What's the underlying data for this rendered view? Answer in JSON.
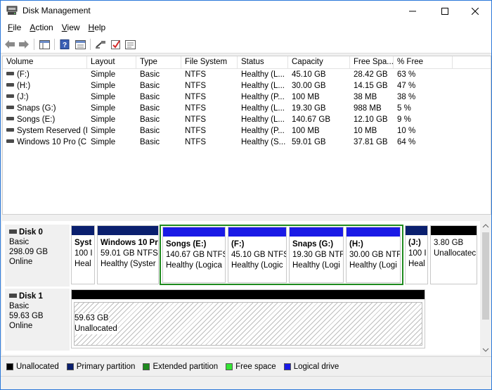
{
  "window": {
    "title": "Disk Management"
  },
  "menu": [
    {
      "label": "File",
      "key": "F",
      "rest": "ile"
    },
    {
      "label": "Action",
      "key": "A",
      "rest": "ction"
    },
    {
      "label": "View",
      "key": "V",
      "rest": "iew"
    },
    {
      "label": "Help",
      "key": "H",
      "rest": "elp"
    }
  ],
  "columns": [
    "Volume",
    "Layout",
    "Type",
    "File System",
    "Status",
    "Capacity",
    "Free Spa...",
    "% Free"
  ],
  "volumes": [
    {
      "volume": "(F:)",
      "layout": "Simple",
      "type": "Basic",
      "fs": "NTFS",
      "status": "Healthy (L...",
      "capacity": "45.10 GB",
      "free": "28.42 GB",
      "pct": "63 %"
    },
    {
      "volume": "(H:)",
      "layout": "Simple",
      "type": "Basic",
      "fs": "NTFS",
      "status": "Healthy (L...",
      "capacity": "30.00 GB",
      "free": "14.15 GB",
      "pct": "47 %"
    },
    {
      "volume": "(J:)",
      "layout": "Simple",
      "type": "Basic",
      "fs": "NTFS",
      "status": "Healthy (P...",
      "capacity": "100 MB",
      "free": "38 MB",
      "pct": "38 %"
    },
    {
      "volume": "Snaps (G:)",
      "layout": "Simple",
      "type": "Basic",
      "fs": "NTFS",
      "status": "Healthy (L...",
      "capacity": "19.30 GB",
      "free": "988 MB",
      "pct": "5 %"
    },
    {
      "volume": "Songs (E:)",
      "layout": "Simple",
      "type": "Basic",
      "fs": "NTFS",
      "status": "Healthy (L...",
      "capacity": "140.67 GB",
      "free": "12.10 GB",
      "pct": "9 %"
    },
    {
      "volume": "System Reserved (I:)",
      "layout": "Simple",
      "type": "Basic",
      "fs": "NTFS",
      "status": "Healthy (P...",
      "capacity": "100 MB",
      "free": "10 MB",
      "pct": "10 %"
    },
    {
      "volume": "Windows 10 Pro (C:)",
      "layout": "Simple",
      "type": "Basic",
      "fs": "NTFS",
      "status": "Healthy (S...",
      "capacity": "59.01 GB",
      "free": "37.81 GB",
      "pct": "64 %"
    }
  ],
  "disks": {
    "disk0": {
      "name": "Disk 0",
      "type": "Basic",
      "size": "298.09 GB",
      "state": "Online",
      "partitions": [
        {
          "line1": "Syst",
          "line2": "100 I",
          "line3": "Heal",
          "kind": "primary"
        },
        {
          "line1": "Windows 10 Pr",
          "line2": "59.01 GB NTFS",
          "line3": "Healthy (Syster",
          "kind": "primary"
        },
        {
          "line1": "Songs  (E:)",
          "line2": "140.67 GB NTFS",
          "line3": "Healthy (Logica",
          "kind": "logical"
        },
        {
          "line1": "(F:)",
          "line2": "45.10 GB NTFS",
          "line3": "Healthy (Logic",
          "kind": "logical"
        },
        {
          "line1": "Snaps  (G:)",
          "line2": "19.30 GB NTF",
          "line3": "Healthy (Logi",
          "kind": "logical"
        },
        {
          "line1": "(H:)",
          "line2": "30.00 GB NTF",
          "line3": "Healthy (Logi",
          "kind": "logical"
        },
        {
          "line1": "(J:)",
          "line2": "100 I",
          "line3": "Heal",
          "kind": "primary"
        },
        {
          "line1": "",
          "line2": "3.80 GB",
          "line3": "Unallocatec",
          "kind": "unallocated"
        }
      ]
    },
    "disk1": {
      "name": "Disk 1",
      "type": "Basic",
      "size": "59.63 GB",
      "state": "Online",
      "partitions": [
        {
          "line1": "59.63 GB",
          "line2": "Unallocated",
          "kind": "unallocated"
        }
      ]
    }
  },
  "legend": [
    {
      "label": "Unallocated",
      "color": "#000000"
    },
    {
      "label": "Primary partition",
      "color": "#0a1f6e"
    },
    {
      "label": "Extended partition",
      "color": "#1e8a1e"
    },
    {
      "label": "Free space",
      "color": "#33e533"
    },
    {
      "label": "Logical drive",
      "color": "#1a1ae6"
    }
  ],
  "colors": {
    "primary": "#0a1f6e",
    "logical": "#1a1ae6",
    "unallocated": "#000000",
    "extended": "#1e8a1e",
    "titlebar_border": "#2b78d9"
  }
}
